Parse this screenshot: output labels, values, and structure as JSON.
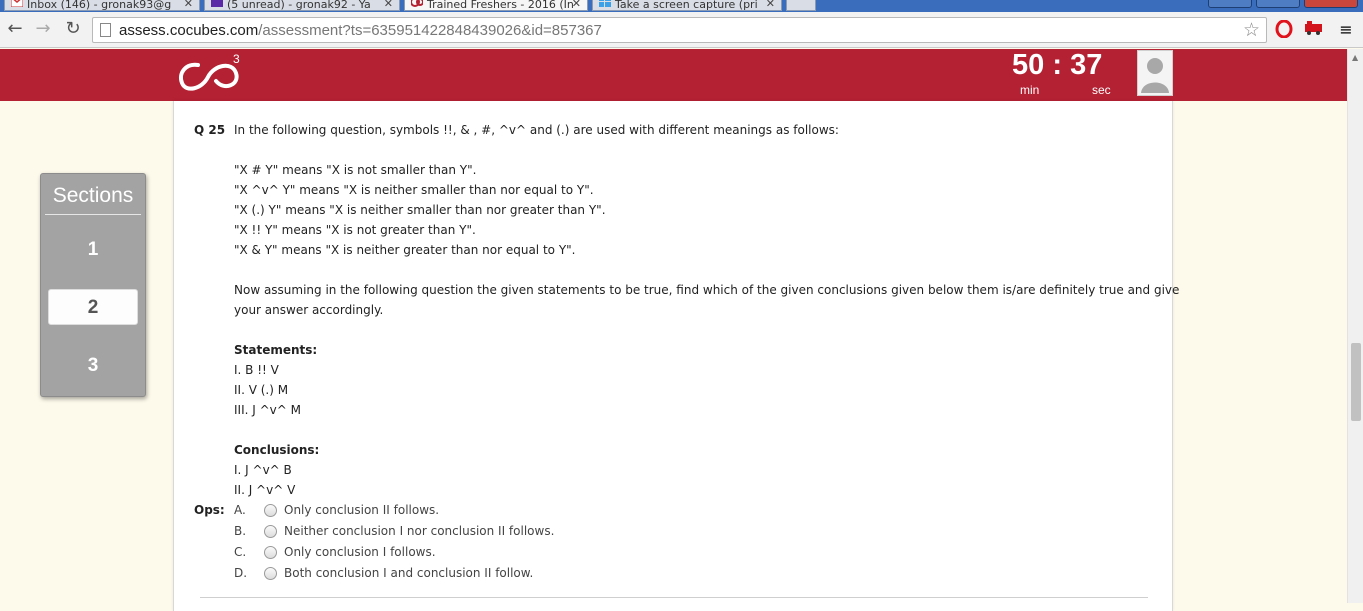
{
  "browser": {
    "tabs": [
      {
        "label": "Inbox (146) - gronak93@g"
      },
      {
        "label": "(5 unread) - gronak92 - Ya"
      },
      {
        "label": "Trained Freshers - 2016 (In"
      },
      {
        "label": "Take a screen capture (pri"
      }
    ],
    "url_domain": "assess.cocubes.com",
    "url_path": "/assessment?ts=635951422848439026&id=857367"
  },
  "header": {
    "logo_sup": "3",
    "timer": {
      "minutes": "50",
      "separator": ":",
      "seconds": "37",
      "min_label": "min",
      "sec_label": "sec"
    },
    "brand_color": "#b32133"
  },
  "sections": {
    "title": "Sections",
    "items": [
      "1",
      "2",
      "3"
    ],
    "active_index": 1
  },
  "question": {
    "number": "Q 25",
    "intro": "In the following question, symbols !!, & , #, ^v^ and (.) are used with different meanings as follows:",
    "meanings": [
      "\"X # Y\" means \"X is not smaller than Y\".",
      "\"X ^v^ Y\" means \"X is neither smaller than nor equal to Y\".",
      "\"X (.) Y\" means \"X is neither smaller than nor greater than Y\".",
      "\"X !! Y\" means \"X is not greater than Y\".",
      "\"X & Y\" means \"X is neither greater than nor equal to Y\"."
    ],
    "instruction_line1": "Now assuming in the following question the given statements to be true, find which of the given conclusions given below them is/are definitely true and give",
    "instruction_line2": "your answer accordingly.",
    "statements_heading": "Statements:",
    "statements": [
      "I. B !! V",
      "II. V (.) M",
      "III. J ^v^ M"
    ],
    "conclusions_heading": "Conclusions:",
    "conclusions": [
      "I. J ^v^ B",
      "II. J ^v^ V"
    ],
    "ops_label": "Ops:",
    "options": [
      {
        "letter": "A.",
        "text": "Only conclusion II follows."
      },
      {
        "letter": "B.",
        "text": "Neither conclusion I nor conclusion II follows."
      },
      {
        "letter": "C.",
        "text": "Only conclusion I follows."
      },
      {
        "letter": "D.",
        "text": "Both conclusion I and conclusion II follow."
      }
    ]
  }
}
